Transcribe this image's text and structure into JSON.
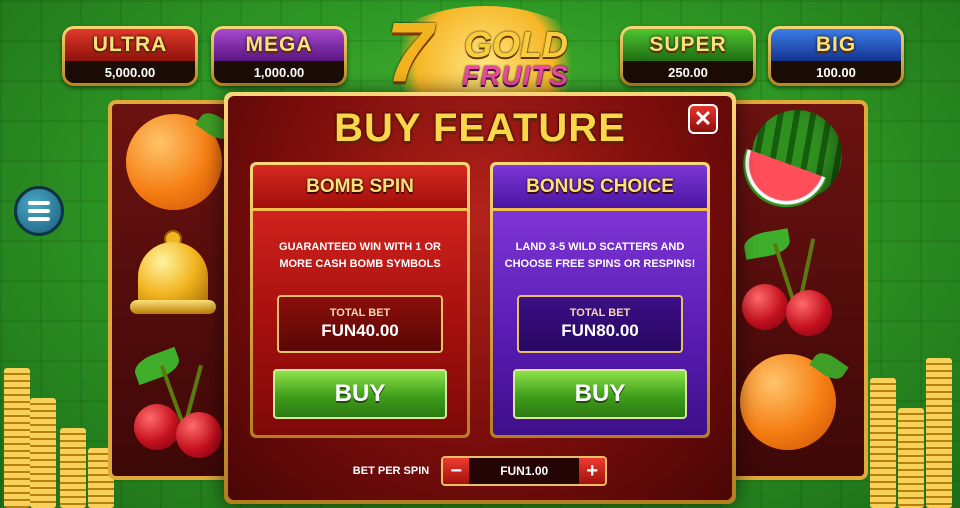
{
  "jackpots": [
    {
      "name": "ULTRA",
      "amount": "5,000.00",
      "color": "#e0392a"
    },
    {
      "name": "MEGA",
      "amount": "1,000.00",
      "color": "#a84ad0"
    },
    {
      "name": "SUPER",
      "amount": "250.00",
      "color": "#4ec52f"
    },
    {
      "name": "BIG",
      "amount": "100.00",
      "color": "#3b7de8"
    }
  ],
  "logo": {
    "seven": "7",
    "gold": "GOLD",
    "fruits": "FRUITS"
  },
  "menu_icon": "hamburger-menu-icon",
  "dialog": {
    "title": "BUY FEATURE",
    "close_icon": "close-icon",
    "cards": [
      {
        "title": "BOMB SPIN",
        "description": "GUARANTEED WIN WITH 1 OR MORE CASH BOMB SYMBOLS",
        "total_bet_label": "TOTAL BET",
        "total_bet_value": "FUN40.00",
        "buy_label": "BUY",
        "color": "#d62a21"
      },
      {
        "title": "BONUS CHOICE",
        "description": "LAND 3-5 WILD SCATTERS AND CHOOSE FREE SPINS OR RESPINS!",
        "total_bet_label": "TOTAL BET",
        "total_bet_value": "FUN80.00",
        "buy_label": "BUY",
        "color": "#7e36d8"
      }
    ],
    "bet_per_spin": {
      "label": "BET PER SPIN",
      "value": "FUN1.00",
      "minus": "−",
      "plus": "+"
    }
  },
  "reel_symbols": {
    "left": [
      "orange",
      "bell",
      "cherry"
    ],
    "right": [
      "watermelon",
      "cherry",
      "orange"
    ]
  }
}
